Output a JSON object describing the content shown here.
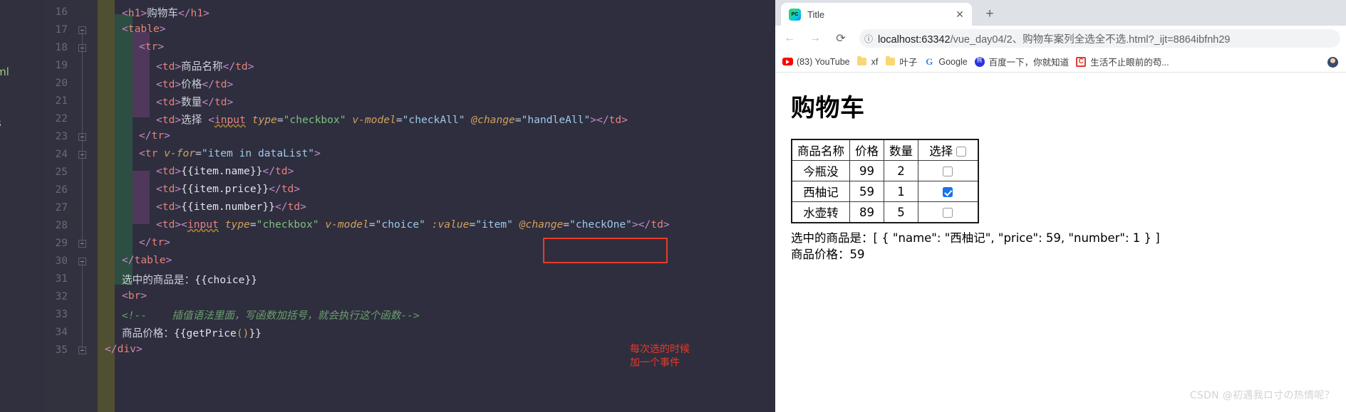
{
  "ide": {
    "file_tree_fragments": [
      "不选.html",
      "s"
    ],
    "line_numbers": [
      16,
      17,
      18,
      19,
      20,
      21,
      22,
      23,
      24,
      25,
      26,
      27,
      28,
      29,
      30,
      31,
      32,
      33,
      34,
      35
    ],
    "code_lines": [
      {
        "n": 16,
        "indent": 1,
        "text": "<h1>购物车</h1>"
      },
      {
        "n": 17,
        "indent": 1,
        "text": "<table>"
      },
      {
        "n": 18,
        "indent": 2,
        "text": "<tr>"
      },
      {
        "n": 19,
        "indent": 3,
        "text": "<td>商品名称</td>"
      },
      {
        "n": 20,
        "indent": 3,
        "text": "<td>价格</td>"
      },
      {
        "n": 21,
        "indent": 3,
        "text": "<td>数量</td>"
      },
      {
        "n": 22,
        "indent": 3,
        "text": "<td>选择 <input type=\"checkbox\" v-model=\"checkAll\" @change=\"handleAll\"></td>"
      },
      {
        "n": 23,
        "indent": 2,
        "text": "</tr>"
      },
      {
        "n": 24,
        "indent": 2,
        "text": "<tr v-for=\"item in dataList\">"
      },
      {
        "n": 25,
        "indent": 3,
        "text": "<td>{{item.name}}</td>"
      },
      {
        "n": 26,
        "indent": 3,
        "text": "<td>{{item.price}}</td>"
      },
      {
        "n": 27,
        "indent": 3,
        "text": "<td>{{item.number}}</td>"
      },
      {
        "n": 28,
        "indent": 3,
        "text": "<td><input type=\"checkbox\" v-model=\"choice\" :value=\"item\" @change=\"checkOne\"></td>"
      },
      {
        "n": 29,
        "indent": 2,
        "text": "</tr>"
      },
      {
        "n": 30,
        "indent": 1,
        "text": "</table>"
      },
      {
        "n": 31,
        "indent": 1,
        "text": "选中的商品是：{{choice}}"
      },
      {
        "n": 32,
        "indent": 1,
        "text": "<br>"
      },
      {
        "n": 33,
        "indent": 1,
        "text": "<!--    插值语法里面，写函数加括号，就会执行这个函数-->"
      },
      {
        "n": 34,
        "indent": 1,
        "text": "商品价格：{{getPrice()}}"
      },
      {
        "n": 35,
        "indent": 0,
        "text": "</div>"
      }
    ],
    "highlighted_snippet": "@change=\"checkOne\"",
    "annotation_note": "每次选的时候\n加一个事件",
    "annotation_color": "#e8382a",
    "highlight_box_color": "#ea3b2a"
  },
  "browser": {
    "tab": {
      "favicon": "phpstorm-icon",
      "title": "Title",
      "close_label": "✕"
    },
    "new_tab_label": "+",
    "nav": {
      "back_label": "←",
      "forward_label": "→",
      "reload_label": "⟳",
      "info_label": "ⓘ"
    },
    "omnibox": {
      "host": "localhost:63342",
      "rest": "/vue_day04/2、购物车案列全选全不选.html?_ijt=8864ibfnh29",
      "full": "localhost:63342/vue_day04/2、购物车案列全选全不选.html?_ijt=8864ibfnh29"
    },
    "bookmarks": [
      {
        "icon": "youtube-icon",
        "label": "(83) YouTube"
      },
      {
        "icon": "folder-icon",
        "label": "xf"
      },
      {
        "icon": "folder-icon",
        "label": "叶子"
      },
      {
        "icon": "google-icon",
        "label": "Google"
      },
      {
        "icon": "baidu-icon",
        "label": "百度一下，你就知道"
      },
      {
        "icon": "csdn-icon",
        "label": "生活不止眼前的苟..."
      }
    ],
    "bookmarks_overflow_icon": "avatar-icon"
  },
  "page": {
    "heading": "购物车",
    "table": {
      "headers": [
        "商品名称",
        "价格",
        "数量",
        "选择"
      ],
      "header_checkbox_checked": false,
      "rows": [
        {
          "name": "今瓶没",
          "price": "99",
          "number": "2",
          "checked": false
        },
        {
          "name": "西柚记",
          "price": "59",
          "number": "1",
          "checked": true
        },
        {
          "name": "水壶转",
          "price": "89",
          "number": "5",
          "checked": false
        }
      ]
    },
    "selected_label": "选中的商品是：",
    "selected_value": "[ { \"name\": \"西柚记\", \"price\": 59, \"number\": 1 } ]",
    "price_label": "商品价格：",
    "price_value": "59",
    "watermark": "CSDN @初遇我ロ寸の热情呢？"
  }
}
